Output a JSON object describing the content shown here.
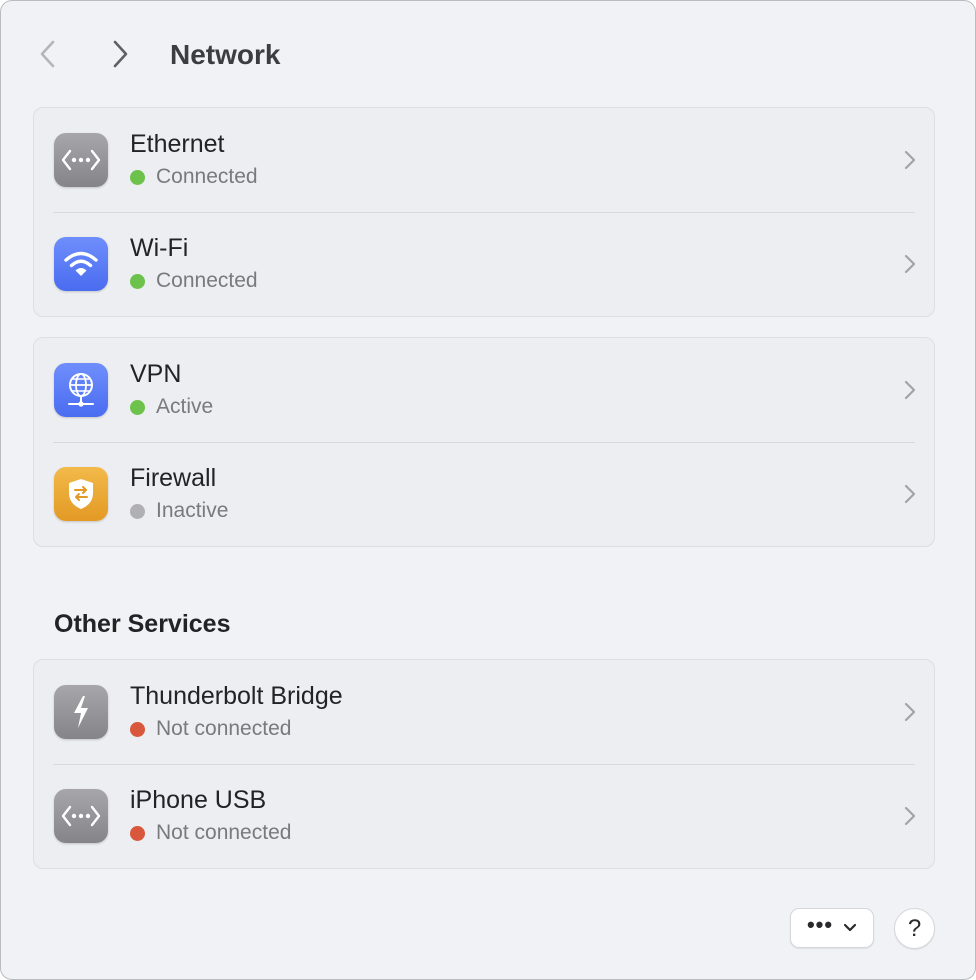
{
  "window": {
    "title": "Network"
  },
  "toolbar": {
    "back_icon": "chevron-left-icon",
    "forward_icon": "chevron-right-icon"
  },
  "groups": [
    {
      "items": [
        {
          "name": "Ethernet",
          "status": "Connected",
          "status_color": "#6cc24a",
          "icon": "ethernet-icon",
          "icon_color": "#8e8e93"
        },
        {
          "name": "Wi-Fi",
          "status": "Connected",
          "status_color": "#6cc24a",
          "icon": "wifi-icon",
          "icon_color": "#5b7cf7"
        }
      ]
    },
    {
      "items": [
        {
          "name": "VPN",
          "status": "Active",
          "status_color": "#6cc24a",
          "icon": "vpn-globe-icon",
          "icon_color": "#5b7cf7"
        },
        {
          "name": "Firewall",
          "status": "Inactive",
          "status_color": "#b0b0b4",
          "icon": "firewall-shield-icon",
          "icon_color": "#e8a535"
        }
      ]
    }
  ],
  "other_services": {
    "heading": "Other Services",
    "items": [
      {
        "name": "Thunderbolt Bridge",
        "status": "Not connected",
        "status_color": "#d9573d",
        "icon": "thunderbolt-icon",
        "icon_color": "#8e8e93"
      },
      {
        "name": "iPhone USB",
        "status": "Not connected",
        "status_color": "#d9573d",
        "icon": "ethernet-icon",
        "icon_color": "#8e8e93"
      }
    ]
  },
  "footer": {
    "more_label": "•••",
    "help_label": "?"
  }
}
